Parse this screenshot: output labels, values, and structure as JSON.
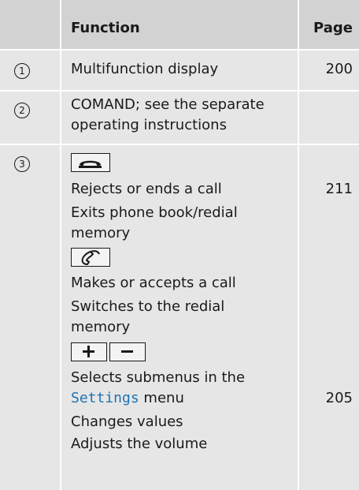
{
  "header": {
    "function": "Function",
    "page": "Page"
  },
  "rows": [
    {
      "num": "1",
      "lines": [
        "Multifunction display"
      ],
      "page": "200"
    },
    {
      "num": "2",
      "lines": [
        "COMAND; see the separate",
        "operating instructions"
      ],
      "page": ""
    },
    {
      "num": "3",
      "group1": [
        "Rejects or ends a call",
        "Exits phone book/redial",
        "memory"
      ],
      "group1_page": "211",
      "group2": [
        "Makes or accepts a call",
        "Switches to the redial",
        "memory"
      ],
      "group3_line1": "Selects submenus in the",
      "group3_settings": "Settings",
      "group3_menu": " menu",
      "group3_page": "205",
      "group3_rest": [
        "Changes values",
        "Adjusts the volume"
      ]
    }
  ],
  "icons": [
    "end-call-icon",
    "accept-call-icon",
    "plus-icon",
    "minus-icon"
  ]
}
